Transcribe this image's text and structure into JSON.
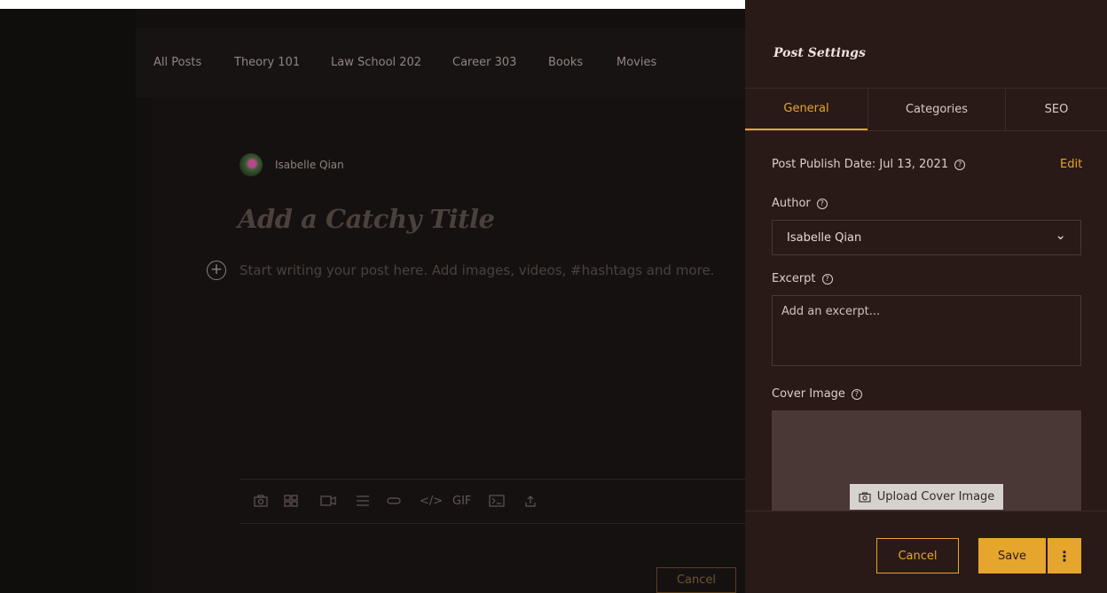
{
  "colors": {
    "accent": "#e6a52d",
    "panel_bg": "#2a1a17",
    "editor_bg": "#130f0e"
  },
  "nav": {
    "items": [
      {
        "label": "All Posts"
      },
      {
        "label": "Theory 101"
      },
      {
        "label": "Law School 202"
      },
      {
        "label": "Career 303"
      },
      {
        "label": "Books"
      },
      {
        "label": "Movies"
      }
    ]
  },
  "editor": {
    "author_name": "Isabelle Qian",
    "title_placeholder": "Add a Catchy Title",
    "body_placeholder": "Start writing your post here. Add images, videos, #hashtags and more.",
    "add_icon": "plus-circle-icon",
    "toolbar": {
      "icons": [
        "camera-icon",
        "gallery-icon",
        "video-icon",
        "divider-icon",
        "button-icon",
        "code-icon",
        "gif-icon",
        "terminal-icon",
        "upload-icon"
      ],
      "gif_label": "GIF",
      "code_label": "</>"
    },
    "cancel_label": "Cancel"
  },
  "settings": {
    "title": "Post Settings",
    "tabs": [
      {
        "label": "General",
        "active": true
      },
      {
        "label": "Categories",
        "active": false
      },
      {
        "label": "SEO",
        "active": false
      }
    ],
    "publish_date_label": "Post Publish Date: Jul 13, 2021",
    "edit_label": "Edit",
    "author_label": "Author",
    "author_value": "Isabelle Qian",
    "excerpt_label": "Excerpt",
    "excerpt_placeholder": "Add an excerpt...",
    "cover_label": "Cover Image",
    "upload_label": "Upload Cover Image",
    "cancel_label": "Cancel",
    "save_label": "Save",
    "help_glyph": "?",
    "more_glyph": "⋮",
    "chevron_glyph": "⌄"
  }
}
